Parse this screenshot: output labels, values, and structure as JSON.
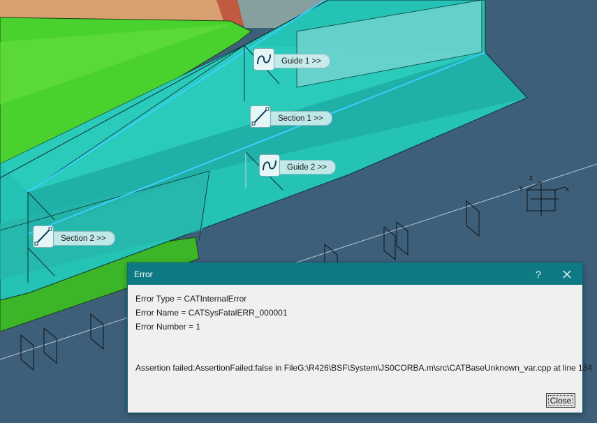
{
  "scene": {
    "tags": {
      "guide1": {
        "label": "Guide 1 >>",
        "icon": "guide-curve-icon"
      },
      "section1": {
        "label": "Section 1 >>",
        "icon": "section-line-icon"
      },
      "guide2": {
        "label": "Guide 2 >>",
        "icon": "guide-curve-icon"
      },
      "section2": {
        "label": "Section 2 >>",
        "icon": "section-line-icon"
      }
    },
    "axis_labels": {
      "x": "x",
      "y": "y",
      "z": "z"
    },
    "colors": {
      "background": "#3d5f7a",
      "solid_cyan": "#1fc6b8",
      "solid_green": "#3cc428",
      "highlight": "#3ad0ff"
    }
  },
  "dialog": {
    "title": "Error",
    "help_label": "?",
    "error_type": "Error Type = CATInternalError",
    "error_name": "Error Name = CATSysFatalERR_000001",
    "error_number": "Error Number = 1",
    "assertion": "Assertion failed:AssertionFailed:false in FileG:\\R426\\BSF\\System\\JS0CORBA.m\\src\\CATBaseUnknown_var.cpp at line 184",
    "close_label": "Close",
    "colors": {
      "titlebar": "#0e7b84",
      "body": "#f0f0f0"
    }
  }
}
